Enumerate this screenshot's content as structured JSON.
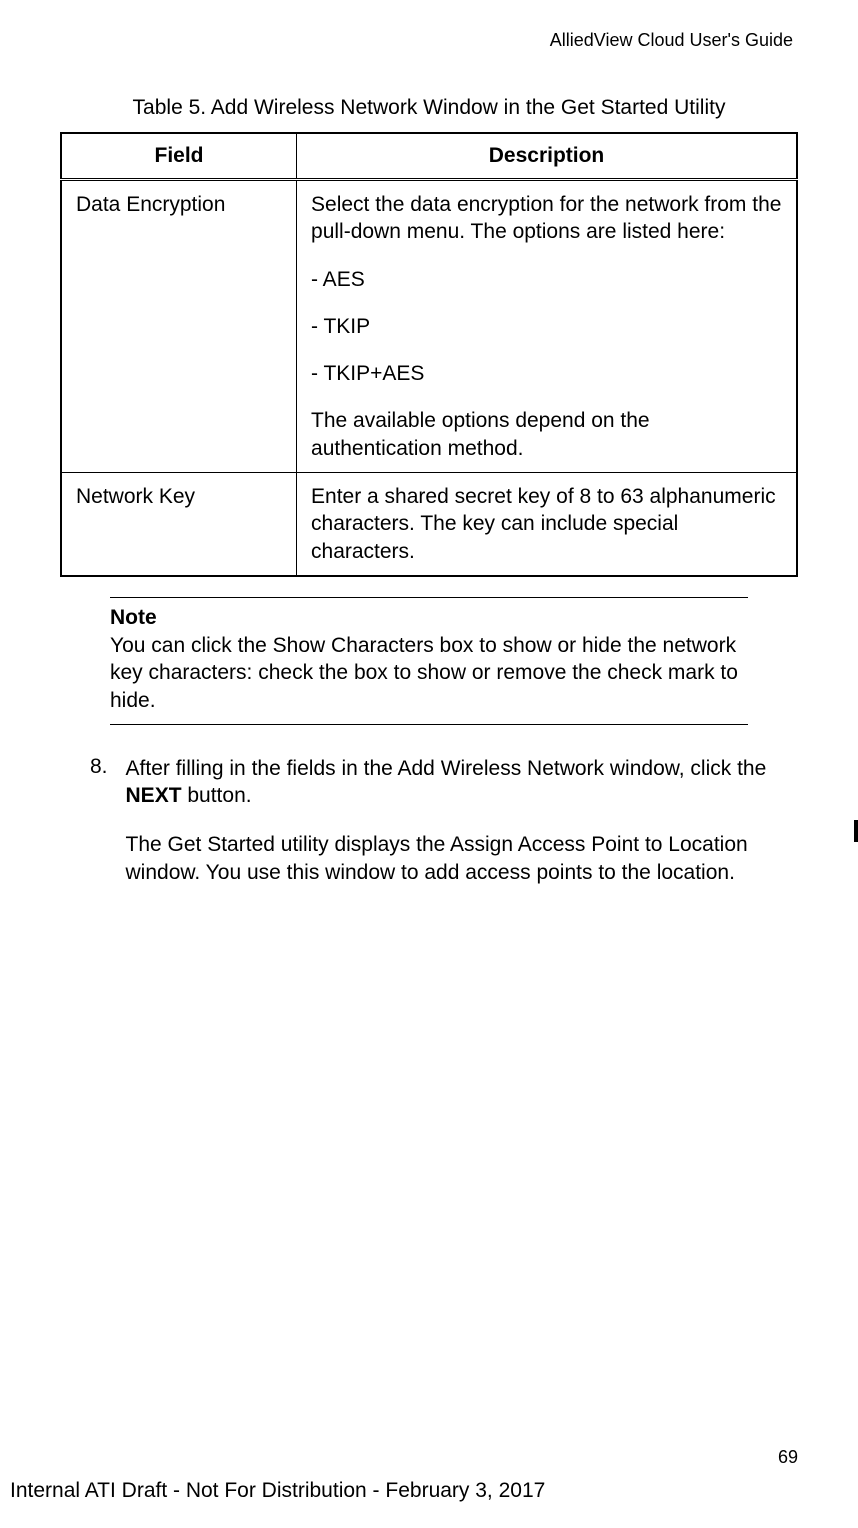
{
  "header": {
    "guide_title": "AlliedView Cloud User's Guide"
  },
  "table": {
    "caption": "Table 5. Add Wireless Network Window in the Get Started Utility",
    "headers": {
      "field": "Field",
      "description": "Description"
    },
    "rows": [
      {
        "field": "Data Encryption",
        "desc_intro": "Select the data encryption for the network from the pull-down menu. The options are listed here:",
        "opt1": "- AES",
        "opt2": "- TKIP",
        "opt3": "- TKIP+AES",
        "desc_outro": "The available options depend on the authentication method."
      },
      {
        "field": "Network Key",
        "desc": "Enter a shared secret key of 8 to 63 alphanumeric characters. The key can include special characters."
      }
    ]
  },
  "note": {
    "label": "Note",
    "text": "You can click the Show Characters box to show or hide the network key characters: check the box to show or remove the check mark to hide."
  },
  "step": {
    "number": "8.",
    "text_before_bold": "After filling in the fields in the Add Wireless Network window, click the ",
    "bold_word": "NEXT",
    "text_after_bold": " button.",
    "paragraph2": "The Get Started utility displays the Assign Access Point to Location window. You use this window to add access points to the location."
  },
  "footer": {
    "page_number": "69",
    "draft_text": "Internal ATI Draft - Not For Distribution - February 3, 2017"
  }
}
